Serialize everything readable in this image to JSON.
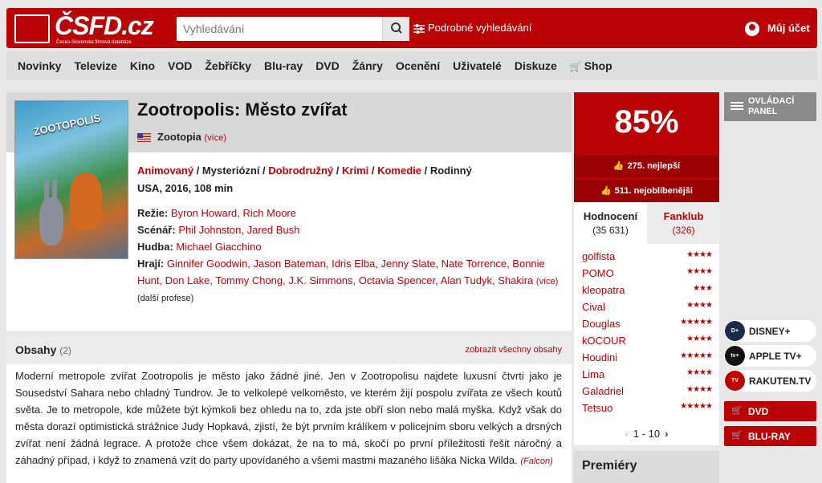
{
  "header": {
    "logo_text": "ČSFD.cz",
    "logo_sub": "Česko-Slovenská filmová databáze",
    "search_placeholder": "Vyhledávání",
    "advanced_search": "Podrobné vyhledávání",
    "account": "Můj účet"
  },
  "nav": {
    "items": [
      "Novinky",
      "Televize",
      "Kino",
      "VOD",
      "Žebříčky",
      "Blu-ray",
      "DVD",
      "Žánry",
      "Ocenění",
      "Uživatelé",
      "Diskuze",
      "Shop"
    ]
  },
  "film": {
    "title": "Zootropolis: Město zvířat",
    "original_title": "Zootopia",
    "original_more": "(více)",
    "genres": [
      "Animovaný",
      "Mysteriózní",
      "Dobrodružný",
      "Krimi",
      "Komedie",
      "Rodinný"
    ],
    "origin": "USA, 2016, 108 min",
    "director_label": "Režie:",
    "directors": "Byron Howard, Rich Moore",
    "writer_label": "Scénář:",
    "writers": "Phil Johnston, Jared Bush",
    "music_label": "Hudba:",
    "music": "Michael Giacchino",
    "cast_label": "Hrají:",
    "cast": "Ginnifer Goodwin, Jason Bateman, Idris Elba, Jenny Slate, Nate Torrence, Bonnie Hunt, Don Lake, Tommy Chong, J.K. Simmons, Octavia Spencer, Alan Tudyk, Shakira",
    "cast_more": "(více)",
    "more_professions": "(další profese)",
    "poster_text": "ZOOTOPOLIS"
  },
  "plot": {
    "title": "Obsahy",
    "count": "(2)",
    "show_all": "zobrazit všechny obsahy",
    "text": "Moderní metropole zvířat Zootropolis je město jako žádné jiné. Jen v Zootropolisu najdete luxusní čtvrti jako je Sousedství Sahara nebo chladný Tundrov. Je to velkolepé velkoměsto, ve kterém žijí pospolu zvířata ze všech koutů světa. Je to metropole, kde můžete být kýmkoli bez ohledu na to, zda jste obří slon nebo malá myška. Když však do města dorazí optimistická strážnice Judy Hopkavá, zjistí, že být prvním králíkem v policejním sboru velkých a drsných zvířat není žádná legrace. A protože chce všem dokázat, že na to má, skočí po první příležitosti řešit náročný a záhadný případ, i když to znamená vzít do party upovídaného a všemi mastmi mazaného lišáka Nicka Wilda.",
    "source": "(Falcon)"
  },
  "rating": {
    "percent": "85%",
    "best": "275. nejlepší",
    "popular": "511. nejoblíbenější",
    "tab_ratings": "Hodnocení",
    "tab_ratings_count": "(35 631)",
    "tab_fanclub": "Fanklub",
    "tab_fanclub_count": "(326)",
    "users": [
      {
        "name": "golfista",
        "stars": 4
      },
      {
        "name": "POMO",
        "stars": 4
      },
      {
        "name": "kleopatra",
        "stars": 3
      },
      {
        "name": "Cival",
        "stars": 4
      },
      {
        "name": "Douglas",
        "stars": 5
      },
      {
        "name": "kOCOUR",
        "stars": 4
      },
      {
        "name": "Houdini",
        "stars": 5
      },
      {
        "name": "Lima",
        "stars": 4
      },
      {
        "name": "Galadriel",
        "stars": 4
      },
      {
        "name": "Tetsuo",
        "stars": 5
      }
    ],
    "pager": "1 - 10",
    "premiery": "Premiéry"
  },
  "sidebar": {
    "panel": "OVLÁDACÍ PANEL",
    "vod": [
      {
        "name": "DISNEY+",
        "icon": "disney-plus-icon",
        "color": "#1b2a4a",
        "badge": "D+"
      },
      {
        "name": "APPLE TV+",
        "icon": "apple-tv-icon",
        "color": "#111111",
        "badge": "tv+"
      },
      {
        "name": "RAKUTEN.TV",
        "icon": "rakuten-tv-icon",
        "color": "#bf0000",
        "badge": "TV"
      }
    ],
    "buy": [
      "DVD",
      "BLU-RAY"
    ]
  },
  "colors": {
    "brand": "#ba0305",
    "brand_dark": "#9b0204"
  }
}
